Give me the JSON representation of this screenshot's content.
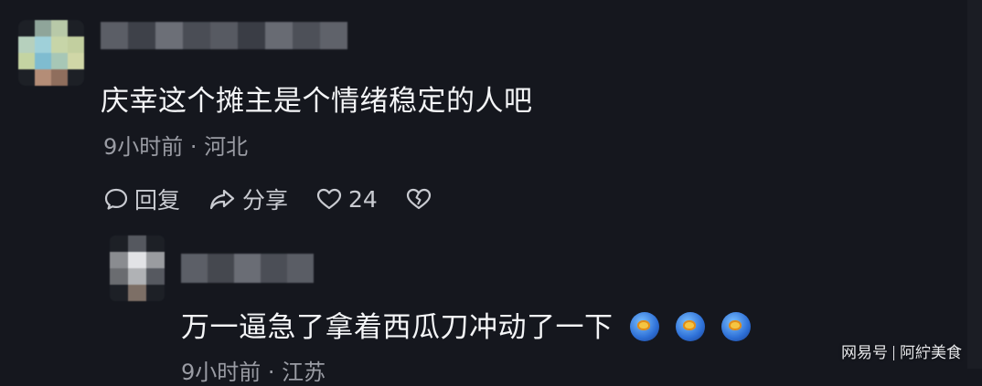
{
  "colors": {
    "background": "#15171e",
    "text_primary": "#f4f5f7",
    "text_secondary": "#9a9ca4",
    "action_text": "#c9cbd1"
  },
  "comment": {
    "text": "庆幸这个摊主是个情绪稳定的人吧",
    "meta": "9小时前 · 河北",
    "actions": {
      "reply_label": "回复",
      "share_label": "分享",
      "like_count": "24"
    }
  },
  "reply": {
    "text": "万一逼急了拿着西瓜刀冲动了一下",
    "emoji_count": 3,
    "meta": "9小时前 · 江苏"
  },
  "watermark": {
    "brand": "网易号",
    "author": "阿紵美食"
  },
  "icons": [
    "comment-icon",
    "share-icon",
    "heart-icon",
    "broken-heart-icon",
    "emoji-icon"
  ]
}
